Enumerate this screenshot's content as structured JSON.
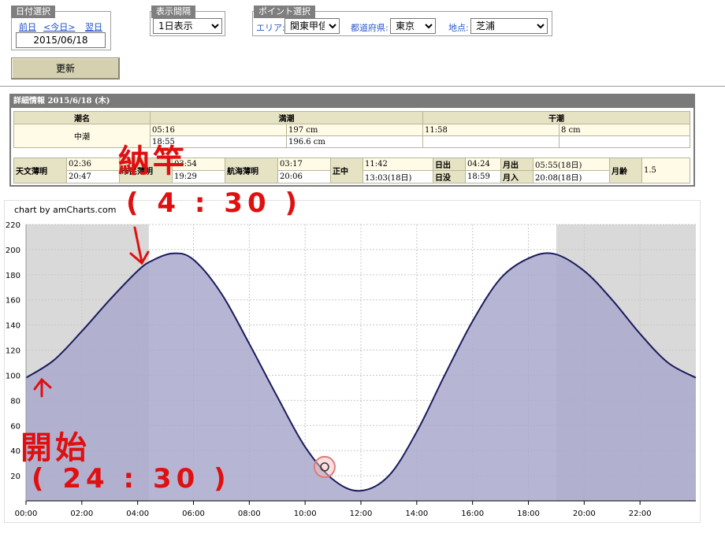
{
  "date_panel": {
    "title": "日付選択",
    "prev": "前日",
    "today": "<今日>",
    "next": "翌日",
    "date": "2015/06/18"
  },
  "interval_panel": {
    "title": "表示間隔",
    "value": "1日表示"
  },
  "point_panel": {
    "title": "ポイント選択",
    "area_label": "エリア:",
    "area_value": "関東甲信",
    "pref_label": "都道府県:",
    "pref_value": "東京",
    "spot_label": "地点:",
    "spot_value": "芝浦"
  },
  "update_button": "更新",
  "detail": {
    "title": "詳細情報 2015/6/18 (木)",
    "headers": {
      "tide_name": "潮名",
      "high": "満潮",
      "low": "干潮"
    },
    "tide_name": "中潮",
    "high_rows": [
      {
        "time": "05:16",
        "level": "197 cm"
      },
      {
        "time": "18:55",
        "level": "196.6 cm"
      }
    ],
    "low_rows": [
      {
        "time": "11:58",
        "level": "8 cm"
      },
      {
        "time": "",
        "level": ""
      }
    ],
    "astro": {
      "astro_twilight_label": "天文薄明",
      "astro_twilight_1": "02:36",
      "astro_twilight_2": "20:47",
      "civil_twilight_label": "市民薄明",
      "civil_twilight_1": "03:54",
      "civil_twilight_2": "19:29",
      "nautical_twilight_label": "航海薄明",
      "nautical_twilight_1": "03:17",
      "nautical_twilight_2": "20:06",
      "noon_label": "正中",
      "noon_1": "11:42",
      "noon_2": "13:03(18日)",
      "sunrise_label": "日出",
      "sunrise": "04:24",
      "sunset_label": "日没",
      "sunset": "18:59",
      "moonrise_label": "月出",
      "moonrise": "05:55(18日)",
      "moonset_label": "月入",
      "moonset": "20:08(18日)",
      "moon_age_label": "月齢",
      "moon_age": "1.5"
    }
  },
  "chart_credit": "chart by amCharts.com",
  "annotations": {
    "top_text": "納竿",
    "top_time": "( 4 : 30 )",
    "bottom_text": "開始",
    "bottom_time": "( 24 : 30 )"
  },
  "colors": {
    "area_fill": "#a9a9cd",
    "line": "#1a1a5c",
    "night_shade": "#d9d9d9",
    "annotation": "#e01010"
  },
  "chart_data": {
    "type": "area",
    "x_ticks": [
      "00:00",
      "02:00",
      "04:00",
      "06:00",
      "08:00",
      "10:00",
      "12:00",
      "14:00",
      "16:00",
      "18:00",
      "20:00",
      "22:00"
    ],
    "y_ticks": [
      20,
      40,
      60,
      80,
      100,
      120,
      140,
      160,
      180,
      200,
      220
    ],
    "xlim_hours": [
      0,
      24
    ],
    "ylim": [
      0,
      220
    ],
    "night_bands_hours": [
      [
        0,
        4.4
      ],
      [
        19.0,
        24
      ]
    ],
    "grid": true,
    "series": [
      {
        "x_hours": [
          0,
          1,
          2,
          3,
          4,
          4.5,
          5.27,
          6,
          7,
          8,
          9,
          10,
          11,
          11.97,
          13,
          14,
          15,
          16,
          17,
          18,
          18.92,
          20,
          21,
          22,
          23,
          24
        ],
        "values": [
          98,
          112,
          135,
          160,
          183,
          191,
          197,
          192,
          165,
          125,
          83,
          43,
          17,
          8,
          20,
          55,
          100,
          143,
          177,
          193,
          196.6,
          183,
          160,
          133,
          110,
          98
        ]
      }
    ],
    "marker": {
      "x_hours": 10.7,
      "value": 27
    }
  }
}
